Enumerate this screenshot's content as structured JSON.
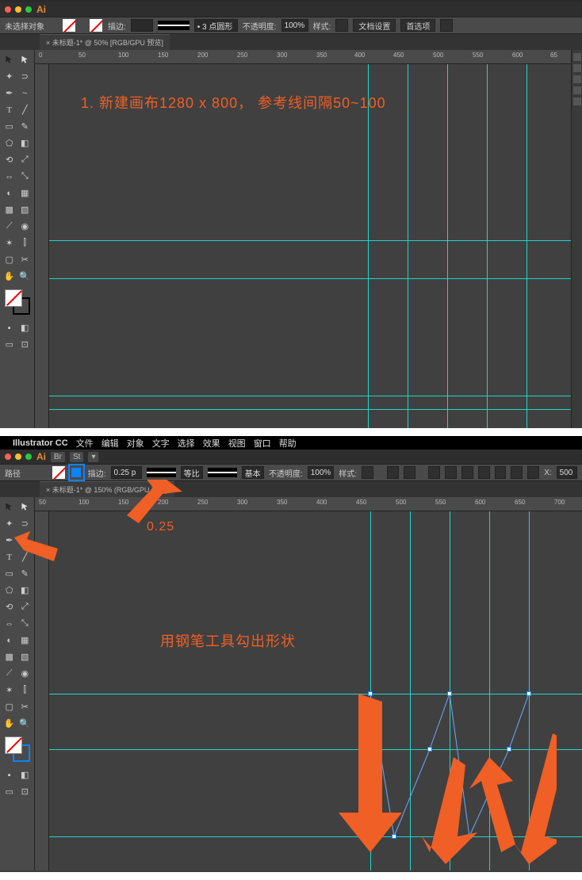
{
  "panel1": {
    "header": {
      "logo": "Ai"
    },
    "control": {
      "selection_label": "未选择对象",
      "stroke_label": "描边:",
      "shape_label": "• 3 点圆形",
      "opacity_label": "不透明度:",
      "opacity_value": "100%",
      "style_label": "样式:",
      "docsetup_btn": "文档设置",
      "prefs_btn": "首选项"
    },
    "tab": "× 未标题-1* @ 50% [RGB/GPU 预览]",
    "ruler_marks": [
      "0",
      "50",
      "100",
      "150",
      "200",
      "250",
      "300",
      "350",
      "400",
      "450",
      "500",
      "550",
      "600",
      "65"
    ],
    "annotation": "1. 新建画布1280 x 800， 参考线间隔50~100"
  },
  "panel2": {
    "menubar": {
      "app": "Illustrator CC",
      "items": [
        "文件",
        "编辑",
        "对象",
        "文字",
        "选择",
        "效果",
        "视图",
        "窗口",
        "帮助"
      ]
    },
    "header": {
      "logo": "Ai",
      "br": "Br",
      "st": "St"
    },
    "control": {
      "path_label": "路径",
      "stroke_label": "描边:",
      "stroke_value": "0.25 p",
      "ratio_label": "等比",
      "basic_label": "基本",
      "opacity_label": "不透明度:",
      "opacity_value": "100%",
      "style_label": "样式:",
      "x_label": "X:",
      "x_value": "500"
    },
    "tab": "× 未标题-1* @ 150% (RGB/GPU 预览)",
    "ruler_marks": [
      "50",
      "100",
      "150",
      "200",
      "250",
      "300",
      "350",
      "400",
      "450",
      "500",
      "550",
      "600",
      "650",
      "700"
    ],
    "annotation_stroke": "0.25",
    "annotation_main": "用钢笔工具勾出形状"
  }
}
